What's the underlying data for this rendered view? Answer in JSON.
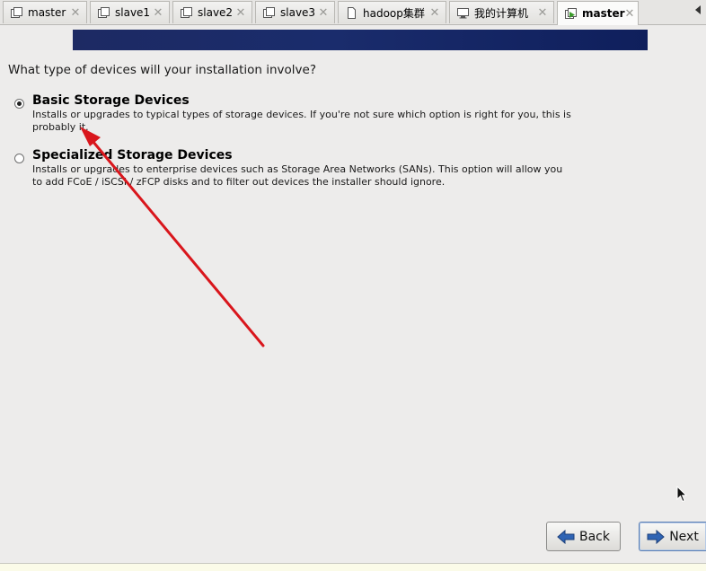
{
  "tabs": [
    {
      "label": "master",
      "icon": "vm-icon"
    },
    {
      "label": "slave1",
      "icon": "vm-icon"
    },
    {
      "label": "slave2",
      "icon": "vm-icon"
    },
    {
      "label": "slave3",
      "icon": "vm-icon"
    },
    {
      "label": "hadoop集群",
      "icon": "document-icon"
    },
    {
      "label": "我的计算机",
      "icon": "computer-icon"
    },
    {
      "label": "master",
      "icon": "vm-running-icon",
      "active": true
    }
  ],
  "installer": {
    "question": "What type of devices will your installation involve?",
    "options": [
      {
        "title": "Basic Storage Devices",
        "description": "Installs or upgrades to typical types of storage devices.  If you're not sure which option is right for you, this is probably it.",
        "selected": true
      },
      {
        "title": "Specialized Storage Devices",
        "description": "Installs or upgrades to enterprise devices such as Storage Area Networks (SANs). This option will allow you to add FCoE / iSCSI / zFCP disks and to filter out devices the installer should ignore.",
        "selected": false
      }
    ],
    "back_label": "Back",
    "next_label": "Next"
  },
  "colors": {
    "banner": "#1a2c6c",
    "annotation_arrow": "#d9161c",
    "button_arrow": "#2f64b4"
  }
}
